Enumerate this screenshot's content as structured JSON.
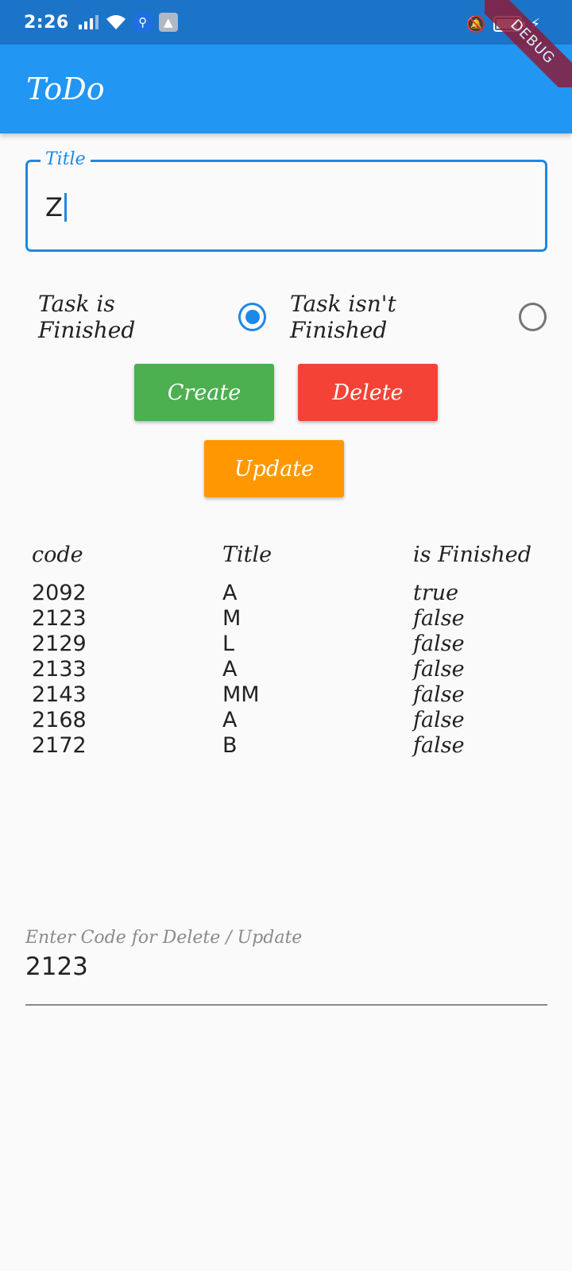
{
  "status_bar": {
    "time": "2:26",
    "icons": [
      "signal-icon",
      "wifi-icon",
      "usb-icon",
      "android-icon",
      "mute-icon",
      "battery-icon",
      "charging-icon"
    ]
  },
  "app_bar": {
    "title": "ToDo",
    "debug_banner": "DEBUG",
    "color": "#2196f3"
  },
  "title_field": {
    "label": "Title",
    "value": "Z"
  },
  "radios": [
    {
      "label": "Task is Finished",
      "selected": true
    },
    {
      "label": "Task isn't Finished",
      "selected": false
    }
  ],
  "buttons": {
    "create": "Create",
    "delete": "Delete",
    "update": "Update",
    "colors": {
      "create": "#4caf50",
      "delete": "#f44336",
      "update": "#ff9800"
    }
  },
  "table": {
    "headers": [
      "code",
      "Title",
      "is Finished"
    ],
    "rows": [
      [
        "2092",
        "A",
        "true"
      ],
      [
        "2123",
        "M",
        "false"
      ],
      [
        "2129",
        "L",
        "false"
      ],
      [
        "2133",
        "A",
        "false"
      ],
      [
        "2143",
        "MM",
        "false"
      ],
      [
        "2168",
        "A",
        "false"
      ],
      [
        "2172",
        "B",
        "false"
      ]
    ]
  },
  "code_field": {
    "hint": "Enter Code for Delete / Update",
    "value": "2123"
  }
}
